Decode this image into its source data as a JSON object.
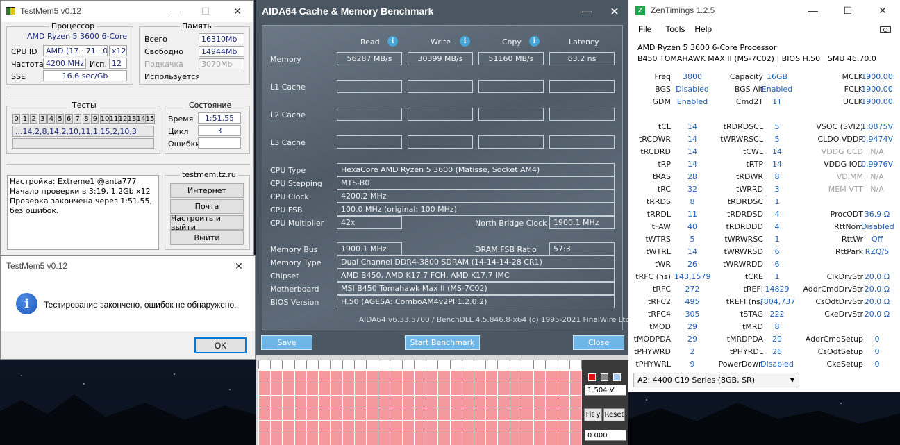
{
  "testmem": {
    "title": "TestMem5 v0.12",
    "cpu_group": "Процессор",
    "cpu_name": "AMD Ryzen 5 3600 6-Core",
    "cpuid_label": "CPU ID",
    "cpuid_value": "AMD  (17 · 71 · 0)",
    "threads_value": "x12",
    "freq_label": "Частота",
    "freq_value": "4200 MHz",
    "used_label": "Исп.",
    "used_value": "12",
    "sse_label": "SSE",
    "sse_value": "16.6 sec/Gb",
    "mem_group": "Память",
    "total_label": "Всего",
    "total_value": "16310Mb",
    "free_label": "Свободно",
    "free_value": "14944Mb",
    "swap_label": "Подкачка",
    "swap_value": "3070Mb",
    "usedmem_label": "Используется",
    "tests_group": "Тесты",
    "test_numbers": [
      "0",
      "1",
      "2",
      "3",
      "4",
      "5",
      "6",
      "7",
      "8",
      "9",
      "10",
      "11",
      "12",
      "13",
      "14",
      "15"
    ],
    "test_sequence": "...14,2,8,14,2,10,11,1,15,2,10,3",
    "state_group": "Состояние",
    "time_label": "Время",
    "time_value": "1:51.55",
    "cycle_label": "Цикл",
    "cycle_value": "3",
    "errors_label": "Ошибки",
    "log_lines": [
      "Настройка: Extreme1 @anta777",
      "Начало проверки в 3:19, 1.2Gb x12",
      "Проверка закончена через 1:51.55,",
      "без ошибок."
    ],
    "site_group": "testmem.tz.ru",
    "btn_internet": "Интернет",
    "btn_mail": "Почта",
    "btn_config": "Настроить и выйти",
    "btn_exit": "Выйти"
  },
  "dialog": {
    "title": "TestMem5 v0.12",
    "message": "Тестирование закончено, ошибок не обнаружено.",
    "ok": "OK"
  },
  "aida": {
    "title": "AIDA64 Cache & Memory Benchmark",
    "col_read": "Read",
    "col_write": "Write",
    "col_copy": "Copy",
    "col_latency": "Latency",
    "row_memory": "Memory",
    "mem_read": "56287 MB/s",
    "mem_write": "30399 MB/s",
    "mem_copy": "51160 MB/s",
    "mem_latency": "63.2 ns",
    "row_l1": "L1 Cache",
    "row_l2": "L2 Cache",
    "row_l3": "L3 Cache",
    "cpu_type_label": "CPU Type",
    "cpu_type": "HexaCore AMD Ryzen 5 3600  (Matisse, Socket AM4)",
    "cpu_stepping_label": "CPU Stepping",
    "cpu_stepping": "MTS-B0",
    "cpu_clock_label": "CPU Clock",
    "cpu_clock": "4200.2 MHz",
    "cpu_fsb_label": "CPU FSB",
    "cpu_fsb": "100.0 MHz  (original: 100 MHz)",
    "cpu_mult_label": "CPU Multiplier",
    "cpu_mult": "42x",
    "nb_clock_label": "North Bridge Clock",
    "nb_clock": "1900.1 MHz",
    "mem_bus_label": "Memory Bus",
    "mem_bus": "1900.1 MHz",
    "dram_ratio_label": "DRAM:FSB Ratio",
    "dram_ratio": "57:3",
    "mem_type_label": "Memory Type",
    "mem_type": "Dual Channel DDR4-3800 SDRAM  (14-14-14-28 CR1)",
    "chipset_label": "Chipset",
    "chipset": "AMD B450, AMD K17.7 FCH, AMD K17.7 IMC",
    "mobo_label": "Motherboard",
    "mobo": "MSI B450 Tomahawk Max II (MS-7C02)",
    "bios_label": "BIOS Version",
    "bios": "H.50  (AGESA: ComboAM4v2PI 1.2.0.2)",
    "footer": "AIDA64 v6.33.5700 / BenchDLL 4.5.846.8-x64  (c) 1995-2021 FinalWire Ltd.",
    "btn_save": "Save",
    "btn_start": "Start Benchmark",
    "btn_close": "Close"
  },
  "graph": {
    "voltage": "1.504 V",
    "btn_fit": "Fit y",
    "btn_reset": "Reset",
    "value": "0.000",
    "colors": {
      "fill": "#f49a9f",
      "red": "#e01010",
      "gray": "#8a8a8a",
      "blue": "#a8cbee"
    }
  },
  "zen": {
    "title": "ZenTimings 1.2.5",
    "menu_file": "File",
    "menu_tools": "Tools",
    "menu_help": "Help",
    "cpu": "AMD Ryzen 5 3600 6-Core Processor",
    "board": "B450 TOMAHAWK MAX II (MS-7C02) | BIOS H.50 | SMU 46.70.0",
    "col1": [
      [
        "Freq",
        "3800"
      ],
      [
        "BGS",
        "Disabled"
      ],
      [
        "GDM",
        "Enabled"
      ],
      [
        "",
        ""
      ],
      [
        "tCL",
        "14"
      ],
      [
        "tRCDWR",
        "14"
      ],
      [
        "tRCDRD",
        "14"
      ],
      [
        "tRP",
        "14"
      ],
      [
        "tRAS",
        "28"
      ],
      [
        "tRC",
        "32"
      ],
      [
        "tRRDS",
        "8"
      ],
      [
        "tRRDL",
        "11"
      ],
      [
        "tFAW",
        "40"
      ],
      [
        "tWTRS",
        "5"
      ],
      [
        "tWTRL",
        "14"
      ],
      [
        "tWR",
        "26"
      ],
      [
        "tRFC (ns)",
        "143,1579"
      ],
      [
        "tRFC",
        "272"
      ],
      [
        "tRFC2",
        "495"
      ],
      [
        "tRFC4",
        "305"
      ],
      [
        "tMOD",
        "29"
      ],
      [
        "tMODPDA",
        "29"
      ],
      [
        "tPHYWRD",
        "2"
      ],
      [
        "tPHYWRL",
        "9"
      ]
    ],
    "col2": [
      [
        "Capacity",
        "16GB"
      ],
      [
        "BGS Alt",
        "Enabled"
      ],
      [
        "Cmd2T",
        "1T"
      ],
      [
        "",
        ""
      ],
      [
        "tRDRDSCL",
        "5"
      ],
      [
        "tWRWRSCL",
        "5"
      ],
      [
        "tCWL",
        "14"
      ],
      [
        "tRTP",
        "14"
      ],
      [
        "tRDWR",
        "8"
      ],
      [
        "tWRRD",
        "3"
      ],
      [
        "tRDRDSC",
        "1"
      ],
      [
        "tRDRDSD",
        "4"
      ],
      [
        "tRDRDDD",
        "4"
      ],
      [
        "tWRWRSC",
        "1"
      ],
      [
        "tWRWRSD",
        "6"
      ],
      [
        "tWRWRDD",
        "6"
      ],
      [
        "tCKE",
        "1"
      ],
      [
        "tREFI",
        "14829"
      ],
      [
        "tREFI (ns)",
        "7804,737"
      ],
      [
        "tSTAG",
        "222"
      ],
      [
        "tMRD",
        "8"
      ],
      [
        "tMRDPDA",
        "20"
      ],
      [
        "tPHYRDL",
        "26"
      ],
      [
        "PowerDown",
        "Disabled"
      ]
    ],
    "col3": [
      [
        "MCLK",
        "1900.00"
      ],
      [
        "FCLK",
        "1900.00"
      ],
      [
        "UCLK",
        "1900.00"
      ],
      [
        "",
        ""
      ],
      [
        "VSOC (SVI2)",
        "1,0875V"
      ],
      [
        "CLDO VDDP",
        "0,9474V"
      ],
      [
        "VDDG CCD",
        "N/A"
      ],
      [
        "VDDG IOD",
        "0,9976V"
      ],
      [
        "VDIMM",
        "N/A"
      ],
      [
        "MEM VTT",
        "N/A"
      ],
      [
        "",
        ""
      ],
      [
        "ProcODT",
        "36.9 Ω"
      ],
      [
        "RttNom",
        "Disabled"
      ],
      [
        "RttWr",
        "Off"
      ],
      [
        "RttPark",
        "RZQ/5"
      ],
      [
        "",
        ""
      ],
      [
        "ClkDrvStr",
        "20.0 Ω"
      ],
      [
        "AddrCmdDrvStr",
        "20.0 Ω"
      ],
      [
        "CsOdtDrvStr",
        "20.0 Ω"
      ],
      [
        "CkeDrvStr",
        "20.0 Ω"
      ],
      [
        "",
        ""
      ],
      [
        "AddrCmdSetup",
        "0"
      ],
      [
        "CsOdtSetup",
        "0"
      ],
      [
        "CkeSetup",
        "0"
      ]
    ],
    "dim_keys": [
      "VDDG CCD",
      "VDIMM",
      "MEM VTT"
    ],
    "module": "A2: 4400 C19 Series (8GB, SR)"
  }
}
